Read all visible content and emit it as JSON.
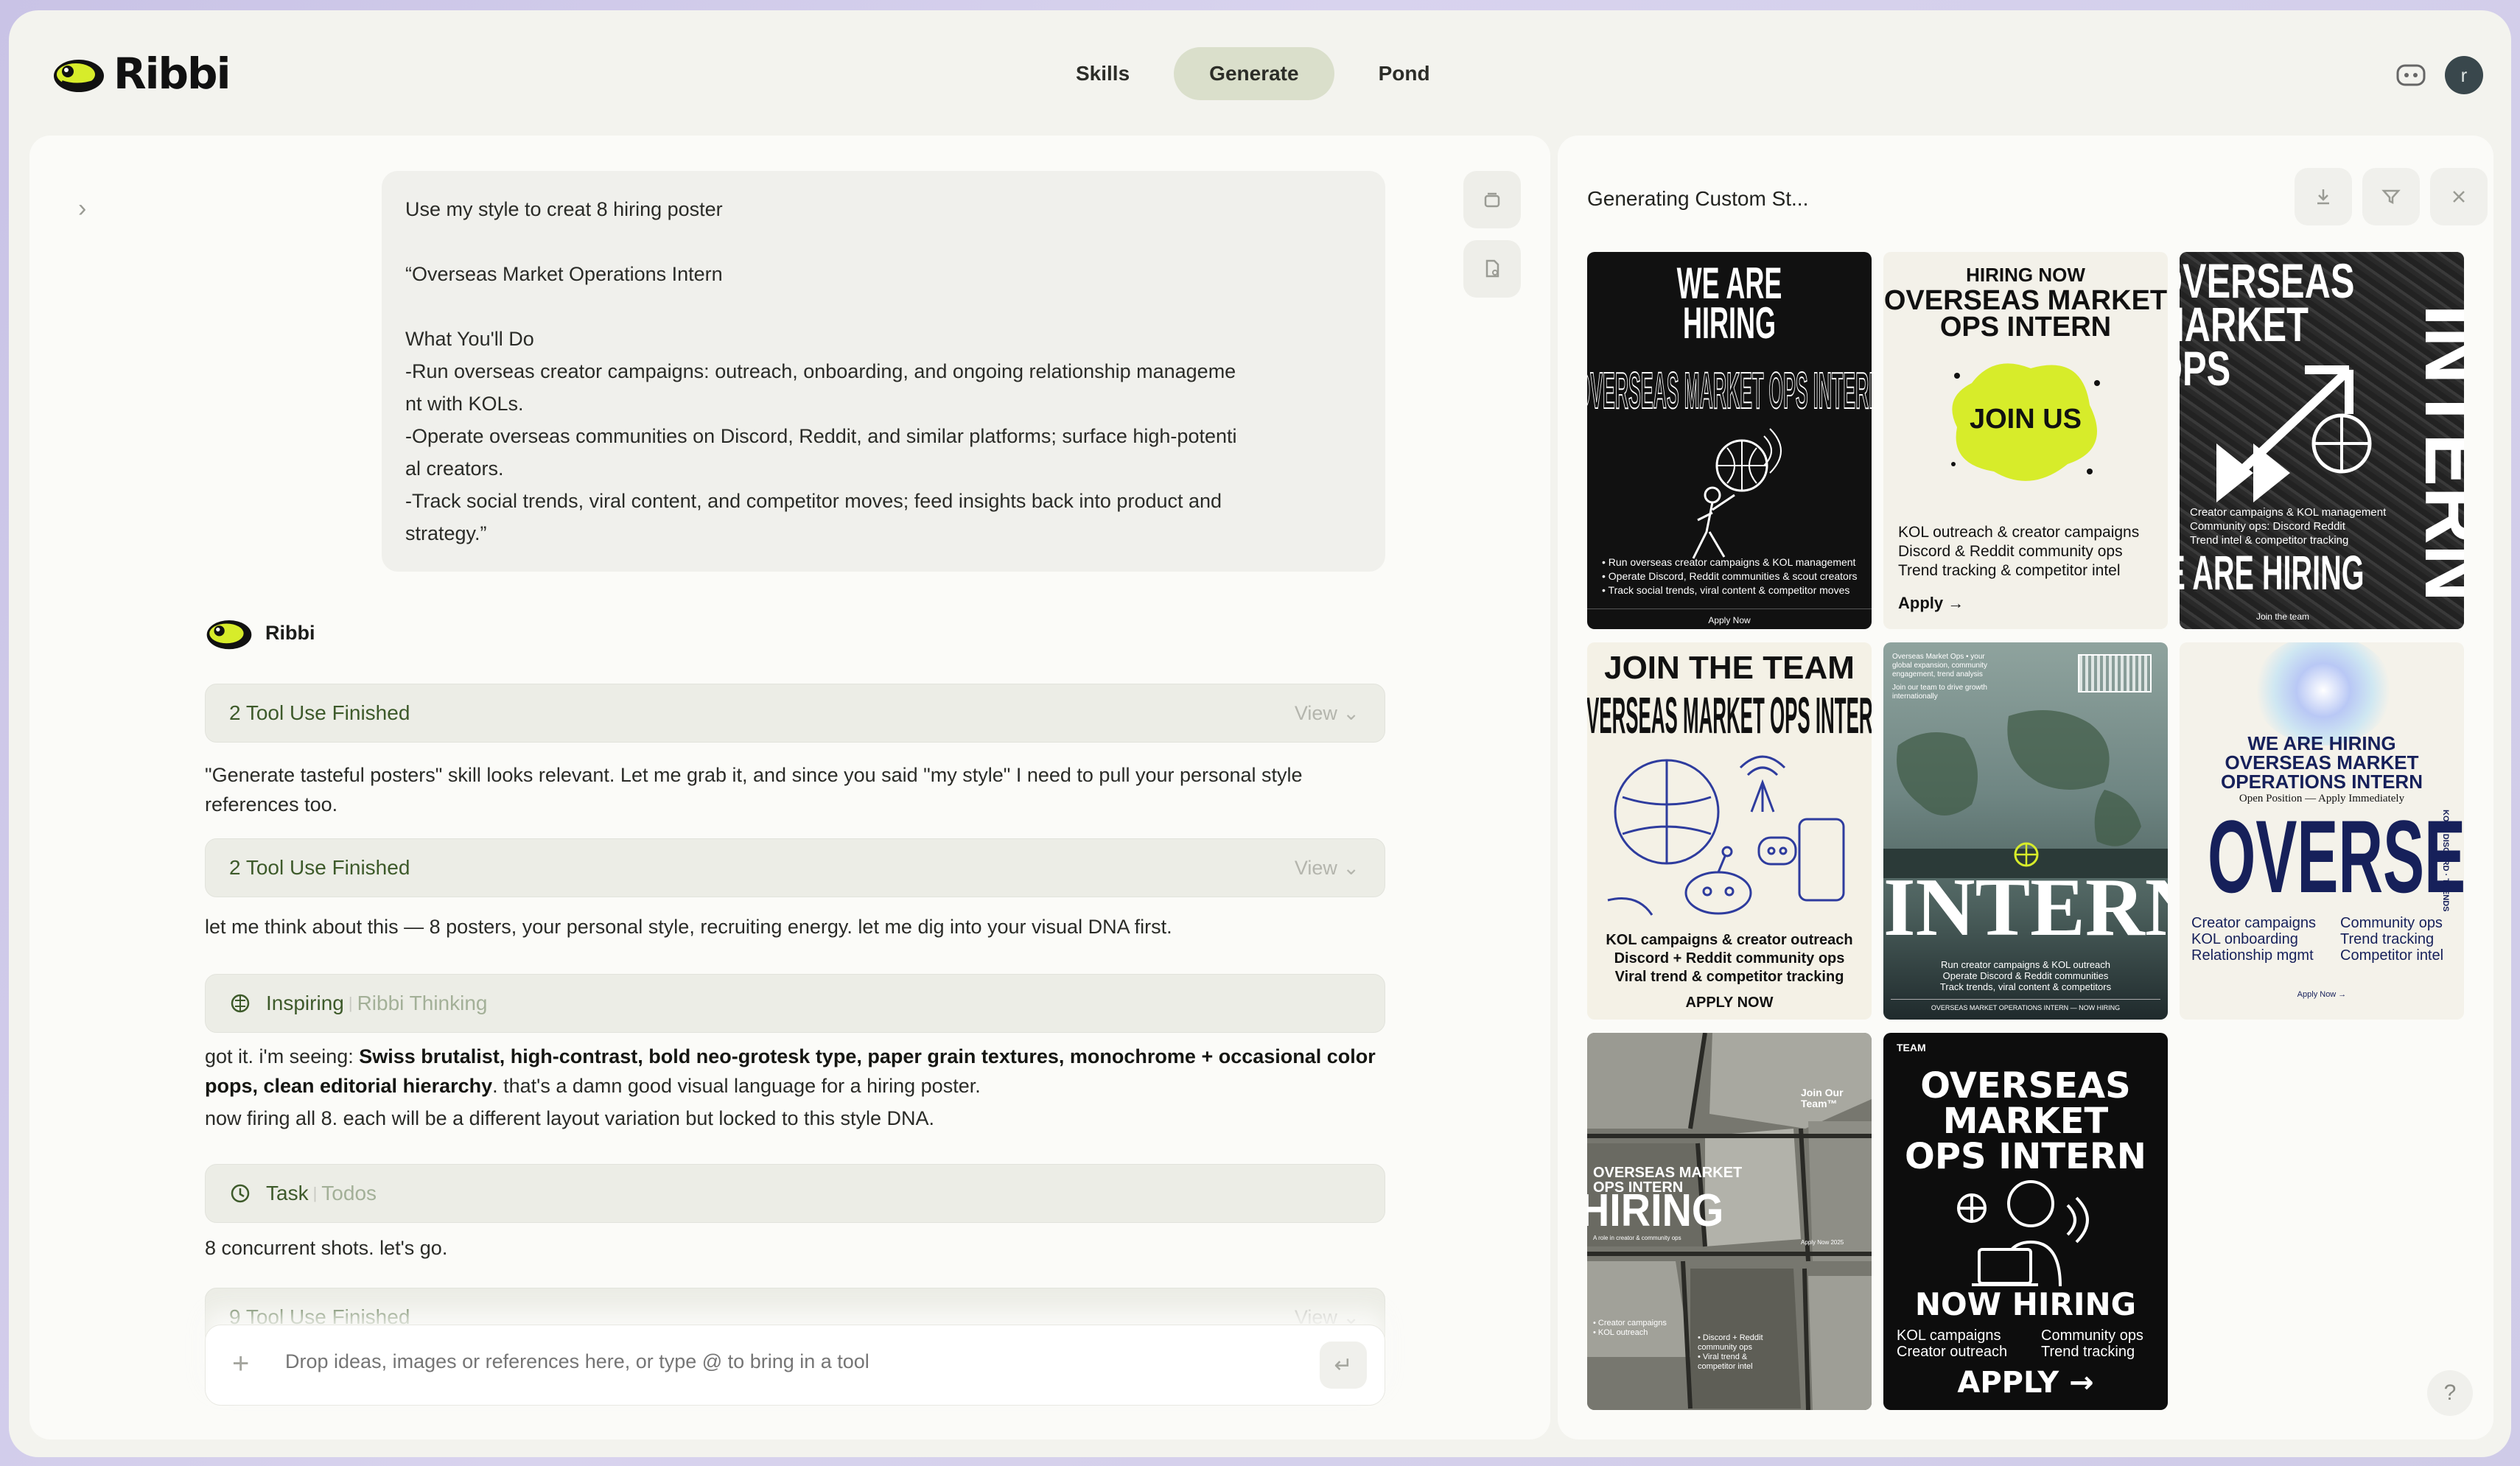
{
  "app": {
    "name": "Ribbi"
  },
  "nav": {
    "tabs": [
      "Skills",
      "Generate",
      "Pond"
    ],
    "active": "Generate"
  },
  "user": {
    "avatar_initial": "r"
  },
  "user_message": {
    "lines": [
      "Use my style to creat 8 hiring poster",
      "",
      "“Overseas Market Operations Intern",
      "",
      "What You'll Do",
      "-Run overseas creator campaigns: outreach, onboarding, and ongoing relationship manageme",
      "nt with KOLs.",
      "-Operate overseas communities on Discord, Reddit, and similar platforms; surface high-potenti",
      "al creators.",
      "-Track social trends, viral content, and competitor moves; feed insights back into product and",
      "strategy.”"
    ]
  },
  "assistant": {
    "name": "Ribbi",
    "tool1": {
      "label": "2 Tool Use Finished",
      "action": "View"
    },
    "para1": "\"Generate tasteful posters\" skill looks relevant. Let me grab it, and since you said \"my style\" I need to pull your personal style references too.",
    "tool2": {
      "label": "2 Tool Use Finished",
      "action": "View"
    },
    "para2": "let me think about this — 8 posters, your personal style, recruiting energy. let me dig into your visual DNA first.",
    "thinking": {
      "label": "Inspiring",
      "sub": "Ribbi Thinking"
    },
    "para3": {
      "prefix": "got it. i'm seeing: ",
      "bold": "Swiss brutalist, high-contrast, bold neo-grotesk type, paper grain textures, monochrome + occasional color pops, clean editorial hierarchy",
      "suffix": ". that's a damn good visual language for a hiring poster."
    },
    "para4": "now firing all 8. each will be a different layout variation but locked to this style DNA.",
    "task": {
      "label": "Task",
      "sub": "Todos"
    },
    "para5": "8 concurrent shots. let's go.",
    "tool3": {
      "label": "9 Tool Use Finished",
      "action": "View"
    }
  },
  "composer": {
    "placeholder": "Drop ideas, images or references here, or type @ to bring in a tool"
  },
  "right_panel": {
    "title": "Generating Custom St..."
  },
  "posters": {
    "p1": {
      "l1": "WE ARE",
      "l2": "HIRING",
      "l3": "OVERSEAS MARKET OPS INTERN",
      "b1": "• Run overseas creator campaigns & KOL management",
      "b2": "• Operate Discord, Reddit communities & scout creators",
      "b3": "• Track social trends, viral content & competitor moves",
      "cta": "Apply Now"
    },
    "p2": {
      "l0": "HIRING NOW",
      "l1": "OVERSEAS MARKET",
      "l2": "OPS INTERN",
      "blob": "JOIN US",
      "b1": "KOL outreach & creator campaigns",
      "b2": "Discord & Reddit community ops",
      "b3": "Trend tracking & competitor intel",
      "cta": "Apply →"
    },
    "p3": {
      "l1": "OVERSEAS",
      "l2": "MARKET",
      "l3": "OPS",
      "side": "INTERN",
      "b1": "Creator campaigns & KOL management",
      "b2": "Community ops: Discord Reddit",
      "b3": "Trend intel & competitor tracking",
      "big": "WE ARE HIRING",
      "cta": "Join the team"
    },
    "p4": {
      "l1": "JOIN THE TEAM",
      "l2": "OVERSEAS MARKET OPS INTERN",
      "b1": "KOL campaigns & creator outreach",
      "b2": "Discord + Reddit community ops",
      "b3": "Viral trend & competitor tracking",
      "cta": "APPLY NOW"
    },
    "p5": {
      "small": "Overseas Market Ops • your global expansion, community engagement, trend analysis",
      "small2": "Join our team to drive growth internationally",
      "big": "INTERN",
      "b1": "Run creator campaigns & KOL outreach",
      "b2": "Operate Discord & Reddit communities",
      "b3": "Track trends, viral content & competitors",
      "foot": "OVERSEAS MARKET OPERATIONS INTERN — NOW HIRING"
    },
    "p6": {
      "l1": "WE ARE HIRING",
      "l2": "OVERSEAS MARKET",
      "l3": "OPERATIONS INTERN",
      "l4": "Open Position — Apply Immediately",
      "big": "OVERSEAS",
      "side": "KOL · DISCORD · TRENDS",
      "c1": [
        "Creator campaigns",
        "KOL onboarding",
        "Relationship mgmt"
      ],
      "c2": [
        "Community ops",
        "Trend tracking",
        "Competitor intel"
      ],
      "cta": "Apply Now →"
    },
    "p7": {
      "tag": "Join Our Team™",
      "l1": "OVERSEAS MARKET",
      "l2": "OPS INTERN",
      "big": "HIRING",
      "small": "A role in creator & community ops",
      "b1": "• Creator campaigns",
      "b2": "• KOL outreach",
      "b3": "• Discord + Reddit community ops",
      "b4": "• Viral trend & competitor intel",
      "date": "Apply Now 2025"
    },
    "p8": {
      "tag": "TEAM",
      "l1": "OVERSEAS",
      "l2": "MARKET",
      "l3": "OPS INTERN",
      "l4": "NOW HIRING",
      "c1": [
        "KOL campaigns",
        "Creator outreach"
      ],
      "c2": [
        "Community ops",
        "Trend tracking"
      ],
      "cta": "APPLY →"
    }
  },
  "colors": {
    "accent": "#dadfcb",
    "lime": "#d7ec2a",
    "green_text": "#3d5a2a",
    "navy": "#16205a"
  }
}
